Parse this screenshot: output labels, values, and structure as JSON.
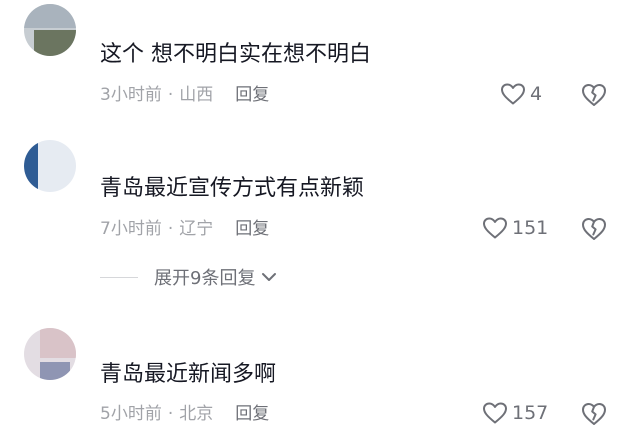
{
  "comments": [
    {
      "username": "",
      "text": "这个  想不明白实在想不明白",
      "time": "3小时前",
      "location": "山西",
      "reply": "回复",
      "likes": "4"
    },
    {
      "username": "",
      "text": "青岛最近宣传方式有点新颖",
      "time": "7小时前",
      "location": "辽宁",
      "reply": "回复",
      "likes": "151"
    },
    {
      "username": "",
      "text": "青岛最近新闻多啊",
      "time": "5小时前",
      "location": "北京",
      "reply": "回复",
      "likes": "157"
    }
  ],
  "expand_replies": "展开9条回复",
  "separator": "·",
  "icons": {
    "like": "heart-outline-icon",
    "dislike": "broken-heart-icon",
    "expand": "chevron-down-icon"
  },
  "colors": {
    "text": "#161823",
    "meta": "#a1a3a8",
    "icon": "#6e7077"
  }
}
